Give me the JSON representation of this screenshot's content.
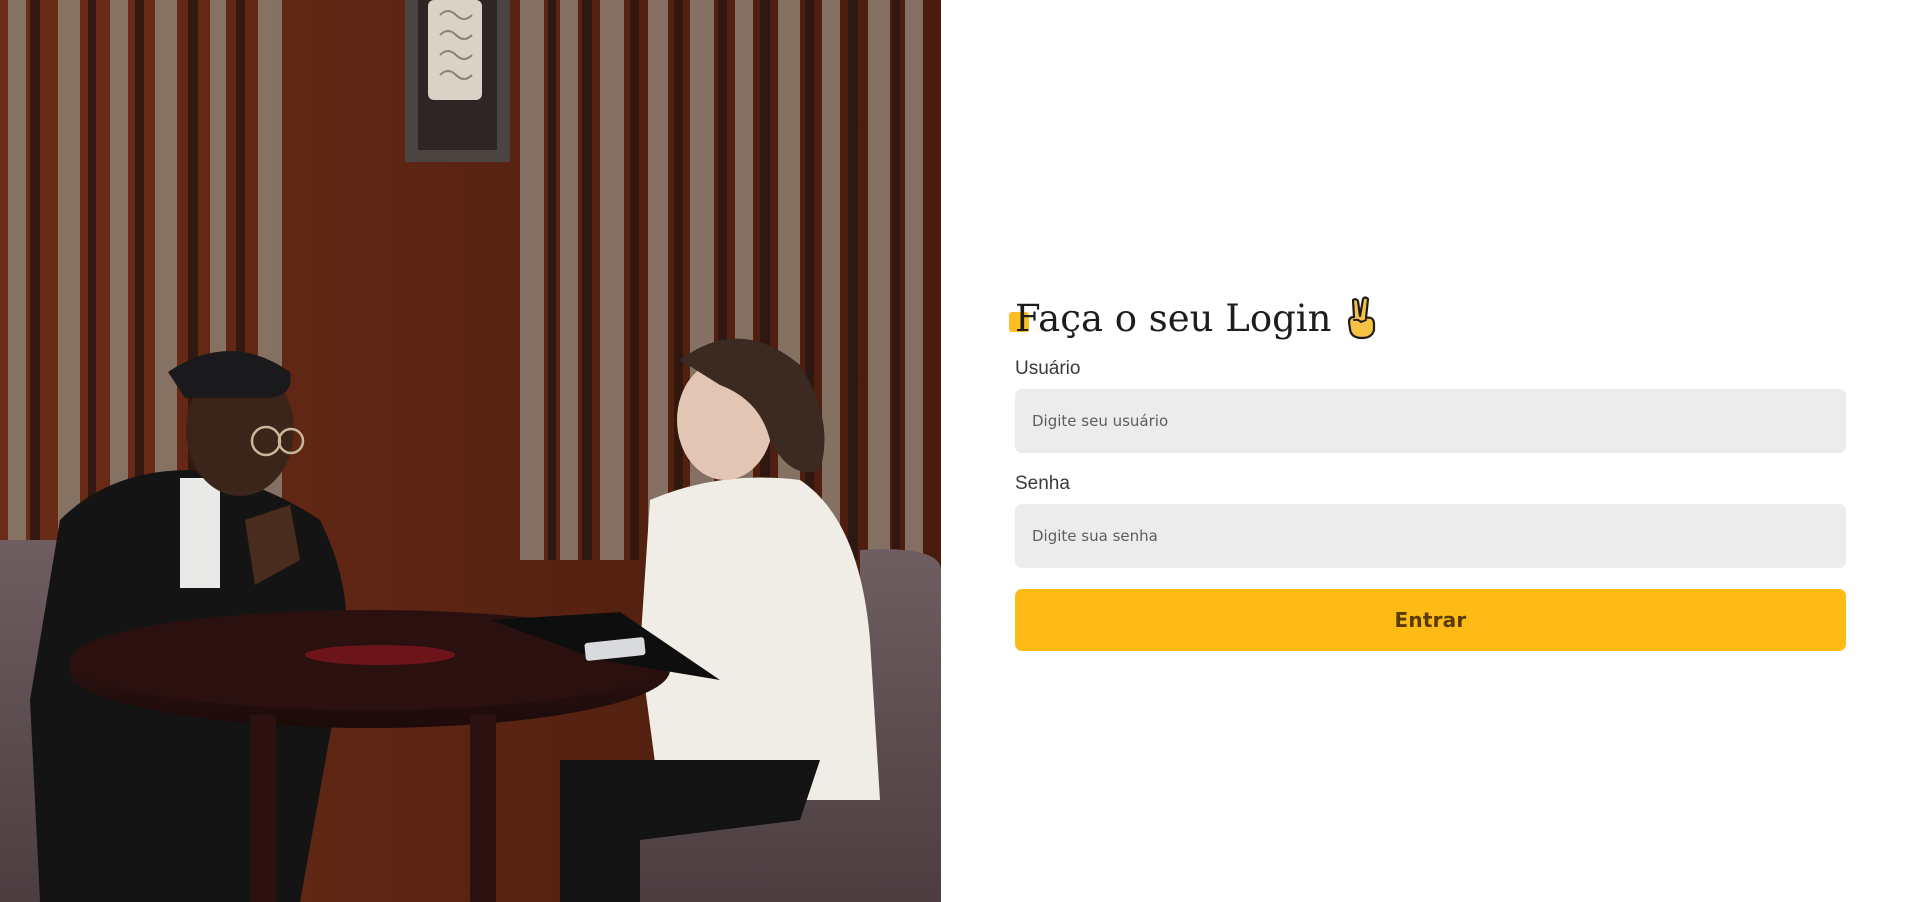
{
  "login": {
    "title": "Faça o seu Login",
    "title_icon": "victory-hand-icon",
    "username": {
      "label": "Usuário",
      "placeholder": "Digite seu usuário",
      "value": ""
    },
    "password": {
      "label": "Senha",
      "placeholder": "Digite sua senha",
      "value": ""
    },
    "submit_label": "Entrar"
  },
  "colors": {
    "accent": "#febb15",
    "button_text": "#5a3b06",
    "input_background": "#ececec",
    "title_text": "#1d1d1d"
  }
}
